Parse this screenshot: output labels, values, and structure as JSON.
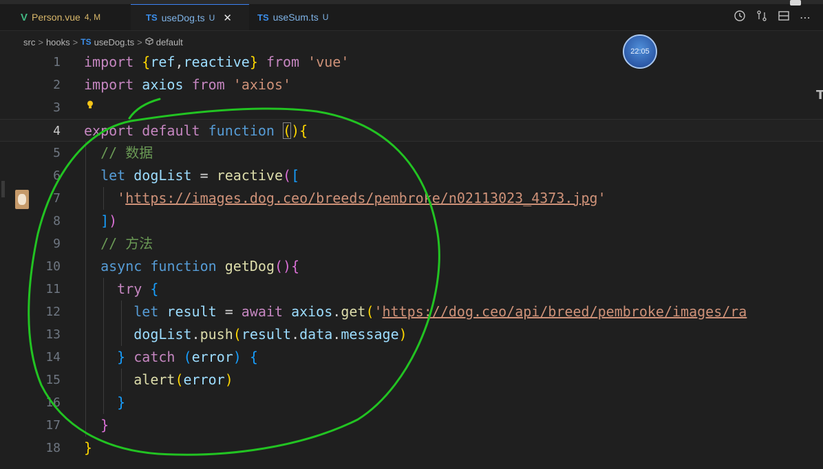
{
  "tabs": [
    {
      "badge": "V",
      "name": "Person.vue",
      "status": "4, M",
      "active": false
    },
    {
      "badge": "TS",
      "name": "useDog.ts",
      "status": "U",
      "active": true,
      "close": "✕"
    },
    {
      "badge": "TS",
      "name": "useSum.ts",
      "status": "U",
      "active": false
    }
  ],
  "breadcrumb": {
    "items": [
      "src",
      "hooks",
      "useDog.ts",
      "default"
    ],
    "file_badge": "TS",
    "separator": ">"
  },
  "clock": {
    "time": "22:05"
  },
  "editor": {
    "line_numbers": [
      "1",
      "2",
      "3",
      "4",
      "5",
      "6",
      "7",
      "8",
      "9",
      "10",
      "11",
      "12",
      "13",
      "14",
      "15",
      "16",
      "17",
      "18"
    ],
    "current_line": 4,
    "lines": [
      "import {ref,reactive} from 'vue'",
      "import axios from 'axios'",
      "",
      "export default function (){",
      "  // 数据",
      "  let dogList = reactive([",
      "    'https://images.dog.ceo/breeds/pembroke/n02113023_4373.jpg'",
      "  ])",
      "  // 方法",
      "  async function getDog(){",
      "    try {",
      "      let result = await axios.get('https://dog.ceo/api/breed/pembroke/images/ra",
      "      dogList.push(result.data.message)",
      "    } catch (error) {",
      "      alert(error)",
      "    }",
      "  }",
      "}"
    ],
    "tokens": {
      "import": "import",
      "from": "from",
      "vue": "'vue'",
      "ref": "ref",
      "reactive": "reactive",
      "axios": "axios",
      "axios_str": "'axios'",
      "export": "export",
      "default": "default",
      "function": "function",
      "comment_data": "// 数据",
      "let": "let",
      "dogList": "dogList",
      "url1": "https://images.dog.ceo/breeds/pembroke/n02113023_4373.jpg",
      "comment_method": "// 方法",
      "async": "async",
      "getDog": "getDog",
      "try": "try",
      "result": "result",
      "await": "await",
      "get": "get",
      "url2": "https://dog.ceo/api/breed/pembroke/images/ra",
      "push": "push",
      "data": "data",
      "message": "message",
      "catch": "catch",
      "error": "error",
      "alert": "alert"
    }
  },
  "annotation": {
    "color": "#22c322"
  }
}
